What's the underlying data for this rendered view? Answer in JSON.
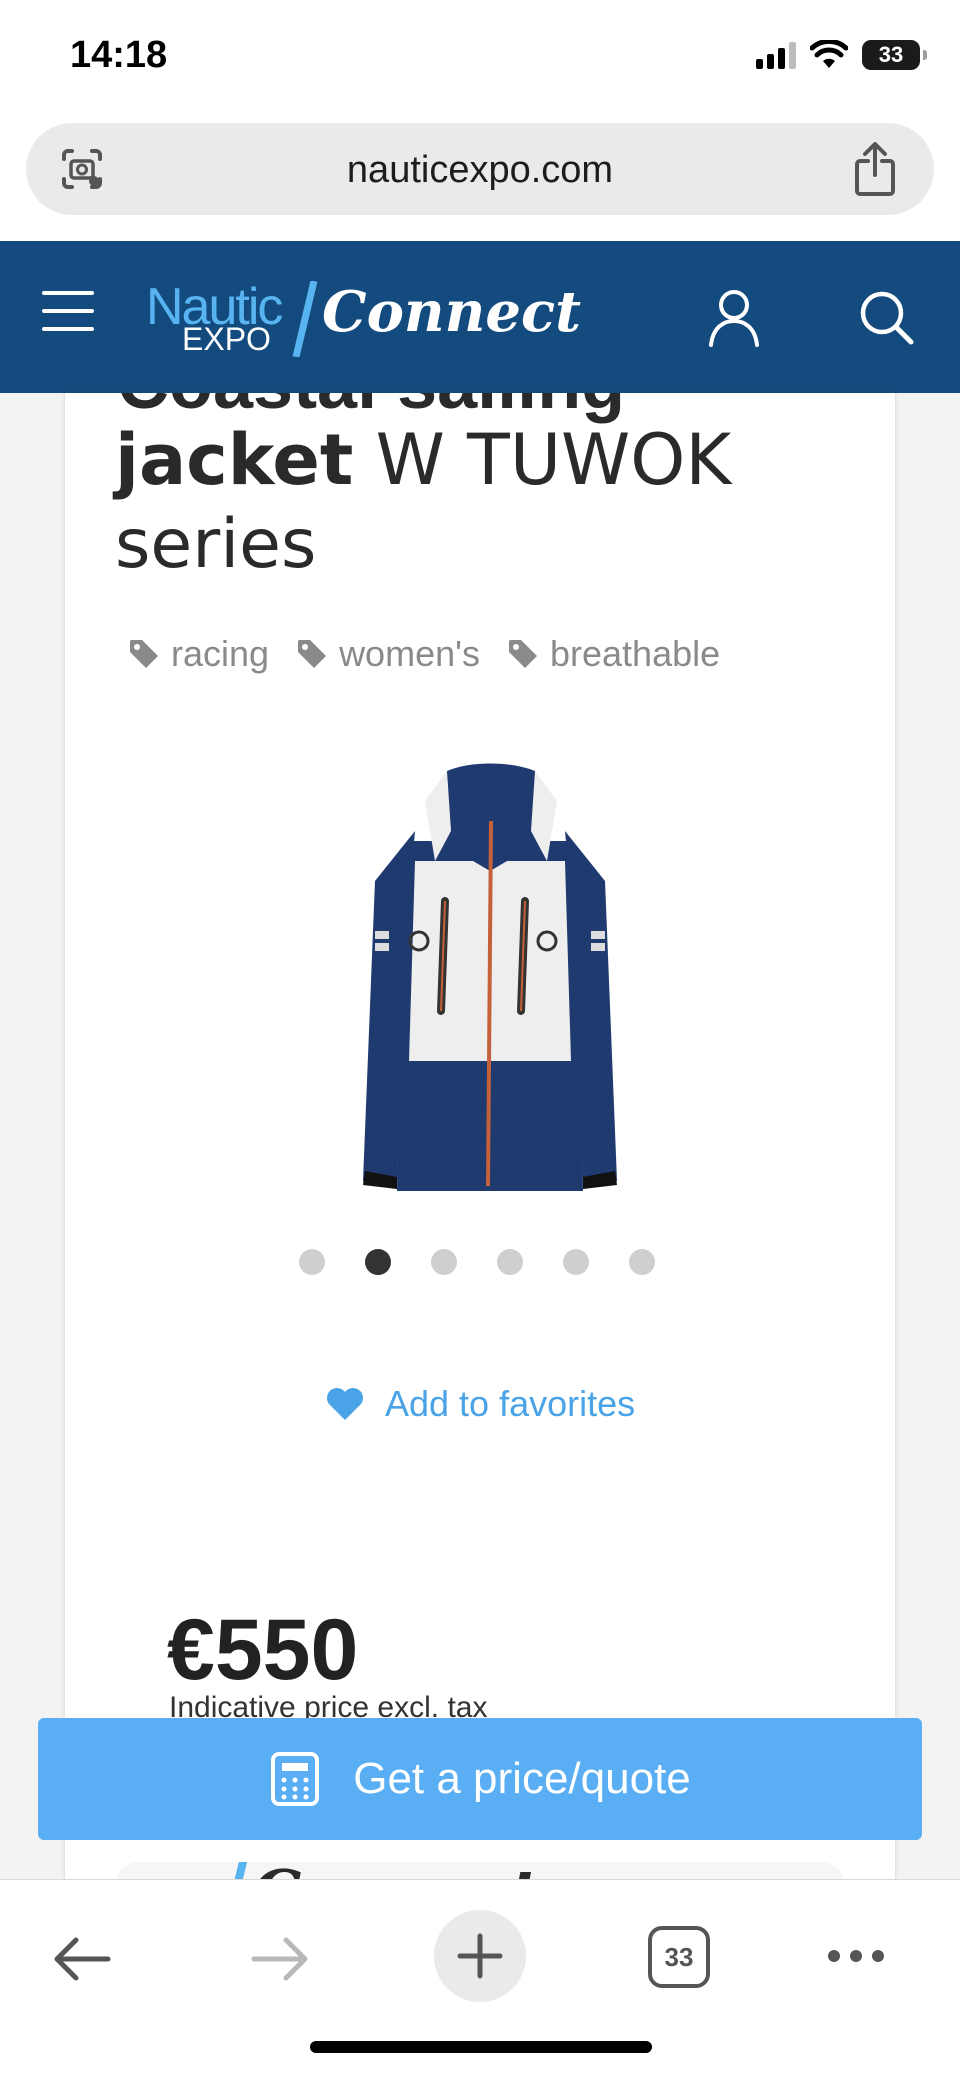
{
  "status_bar": {
    "time": "14:18",
    "battery": "33"
  },
  "browser": {
    "url": "nauticexpo.com",
    "tab_count": "33"
  },
  "site_header": {
    "logo": {
      "nautic": "Nautic",
      "expo": "EXPO",
      "connect": "Connect"
    }
  },
  "product": {
    "title_line0": "Coastal sailing",
    "title_bold": "jacket",
    "title_rest": " W TUWOK",
    "title_line2": "series",
    "tags": [
      "racing",
      "women's",
      "breathable"
    ],
    "carousel": {
      "total": 6,
      "active_index": 1
    },
    "favorite_label": "Add to favorites",
    "price": "€550",
    "price_note": "Indicative price excl. tax",
    "quote_label": "Get a price/quote"
  },
  "colors": {
    "header_bg": "#144b7e",
    "accent_blue": "#5aaef3",
    "link_blue": "#4aa3e6",
    "jacket_navy": "#1f3a6e"
  },
  "icons": {
    "url_left": "visual-lookup-icon",
    "url_right": "share-icon",
    "header_left": "hamburger-menu-icon",
    "header_account": "user-icon",
    "header_search": "search-icon",
    "tag": "tag-icon",
    "favorite": "heart-icon",
    "quote": "calculator-icon",
    "back": "arrow-left-icon",
    "forward": "arrow-right-icon",
    "new_tab": "plus-icon",
    "more": "more-dots-icon"
  }
}
